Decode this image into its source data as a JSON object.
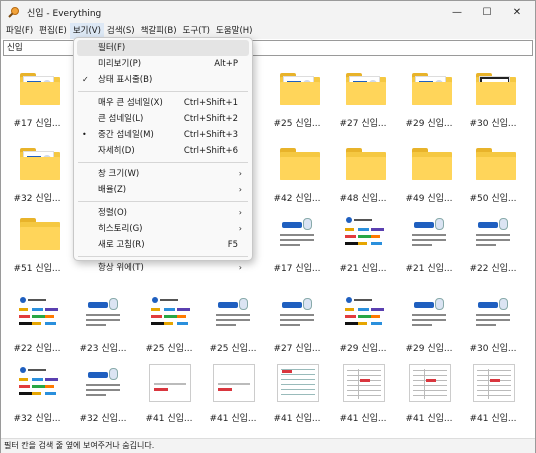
{
  "window": {
    "title": "신입 - Everything",
    "minimize": "—",
    "maximize": "☐",
    "close": "✕"
  },
  "menubar": [
    {
      "label": "파일(F)"
    },
    {
      "label": "편집(E)"
    },
    {
      "label": "보기(V)"
    },
    {
      "label": "검색(S)"
    },
    {
      "label": "책갈피(B)"
    },
    {
      "label": "도구(T)"
    },
    {
      "label": "도움말(H)"
    }
  ],
  "search": {
    "value": "신입"
  },
  "dropdown": [
    {
      "label": "필터(F)",
      "shortcut": "",
      "submenu": false,
      "mark": "",
      "highlight": true
    },
    {
      "label": "미리보기(P)",
      "shortcut": "Alt+P",
      "submenu": false,
      "mark": ""
    },
    {
      "label": "상태 표시줄(B)",
      "shortcut": "",
      "submenu": false,
      "mark": "✓"
    },
    {
      "sep": true
    },
    {
      "label": "매우 큰 섬네일(X)",
      "shortcut": "Ctrl+Shift+1",
      "submenu": false,
      "mark": ""
    },
    {
      "label": "큰 섬네일(L)",
      "shortcut": "Ctrl+Shift+2",
      "submenu": false,
      "mark": ""
    },
    {
      "label": "중간 섬네일(M)",
      "shortcut": "Ctrl+Shift+3",
      "submenu": false,
      "mark": "•"
    },
    {
      "label": "자세히(D)",
      "shortcut": "Ctrl+Shift+6",
      "submenu": false,
      "mark": ""
    },
    {
      "sep": true
    },
    {
      "label": "창 크기(W)",
      "shortcut": "",
      "submenu": true,
      "mark": ""
    },
    {
      "label": "배율(Z)",
      "shortcut": "",
      "submenu": true,
      "mark": ""
    },
    {
      "sep": true
    },
    {
      "label": "정렬(O)",
      "shortcut": "",
      "submenu": true,
      "mark": ""
    },
    {
      "label": "히스토리(G)",
      "shortcut": "",
      "submenu": true,
      "mark": ""
    },
    {
      "label": "새로 고침(R)",
      "shortcut": "F5",
      "submenu": false,
      "mark": ""
    },
    {
      "sep": true
    },
    {
      "label": "항상 위에(T)",
      "shortcut": "",
      "submenu": true,
      "mark": ""
    }
  ],
  "items": [
    {
      "label": "#17 신입...",
      "kind": "folder-doc"
    },
    {
      "label": "",
      "kind": "hidden"
    },
    {
      "label": "",
      "kind": "hidden"
    },
    {
      "label": "",
      "kind": "hidden"
    },
    {
      "label": "#25 신입...",
      "kind": "folder-doc"
    },
    {
      "label": "#27 신입...",
      "kind": "folder-doc"
    },
    {
      "label": "#29 신입...",
      "kind": "folder-doc"
    },
    {
      "label": "#30 신입...",
      "kind": "folder-dark"
    },
    {
      "label": "#32 신입...",
      "kind": "folder-doc"
    },
    {
      "label": "",
      "kind": "hidden"
    },
    {
      "label": "",
      "kind": "hidden"
    },
    {
      "label": "",
      "kind": "hidden"
    },
    {
      "label": "#42 신입...",
      "kind": "folder-plain"
    },
    {
      "label": "#48 신입...",
      "kind": "folder-plain"
    },
    {
      "label": "#49 신입...",
      "kind": "folder-plain"
    },
    {
      "label": "#50 신입...",
      "kind": "folder-plain"
    },
    {
      "label": "#51 신입...",
      "kind": "folder-plain"
    },
    {
      "label": "",
      "kind": "hidden"
    },
    {
      "label": "",
      "kind": "hidden"
    },
    {
      "label": "",
      "kind": "hidden"
    },
    {
      "label": "#17 신입...",
      "kind": "card-logo"
    },
    {
      "label": "#21 신입...",
      "kind": "card-tags"
    },
    {
      "label": "#21 신입...",
      "kind": "card-logo"
    },
    {
      "label": "#22 신입...",
      "kind": "card-logo"
    },
    {
      "label": "#22 신입...",
      "kind": "card-tags"
    },
    {
      "label": "#23 신입...",
      "kind": "card-logo"
    },
    {
      "label": "#25 신입...",
      "kind": "card-tags"
    },
    {
      "label": "#25 신입...",
      "kind": "card-logo"
    },
    {
      "label": "#27 신입...",
      "kind": "card-logo"
    },
    {
      "label": "#29 신입...",
      "kind": "card-tags"
    },
    {
      "label": "#29 신입...",
      "kind": "card-logo"
    },
    {
      "label": "#30 신입...",
      "kind": "card-logo"
    },
    {
      "label": "#32 신입...",
      "kind": "card-tags"
    },
    {
      "label": "#32 신입...",
      "kind": "card-logo"
    },
    {
      "label": "#41 신입...",
      "kind": "doc-red"
    },
    {
      "label": "#41 신입...",
      "kind": "doc-red"
    },
    {
      "label": "#41 신입...",
      "kind": "doc-sheet"
    },
    {
      "label": "#41 신입...",
      "kind": "doc-table"
    },
    {
      "label": "#41 신입...",
      "kind": "doc-table"
    },
    {
      "label": "#41 신입...",
      "kind": "doc-table"
    }
  ],
  "status": {
    "text": "필터 칸을 검색 줄 옆에 보여주거나 숨깁니다."
  },
  "colors": {
    "folder": "#f5c842",
    "folder_dark": "#e8b32a",
    "menu_active": "#dde8f5",
    "logo_blue": "#1f5fbf"
  }
}
